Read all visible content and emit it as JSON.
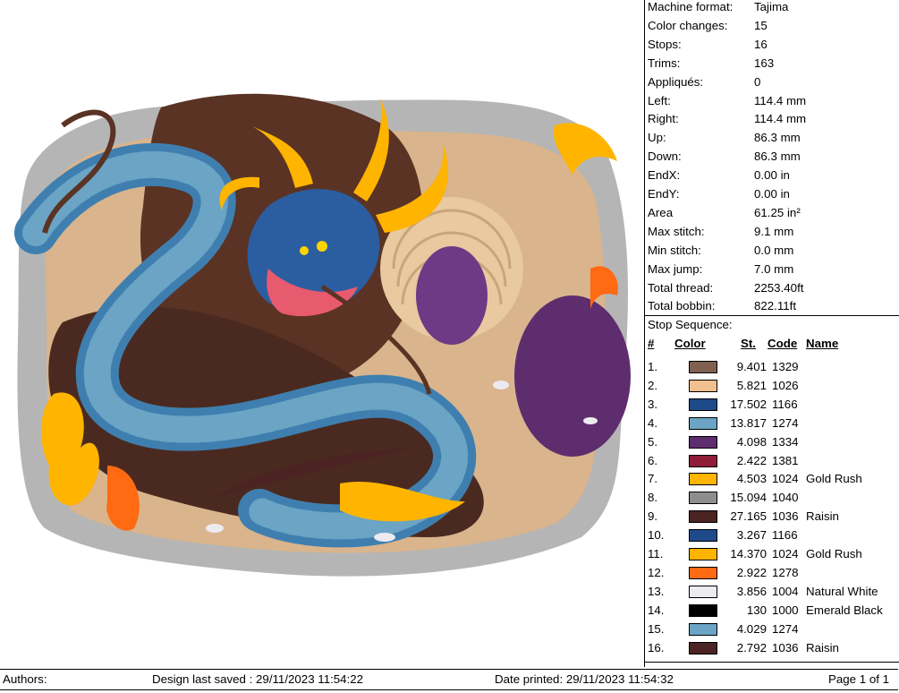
{
  "stats": [
    {
      "label": "Machine format:",
      "value": "Tajima"
    },
    {
      "label": "Color changes:",
      "value": "15"
    },
    {
      "label": "Stops:",
      "value": "16"
    },
    {
      "label": "Trims:",
      "value": "163"
    },
    {
      "label": "Appliqués:",
      "value": "0"
    },
    {
      "label": "Left:",
      "value": "114.4 mm"
    },
    {
      "label": "Right:",
      "value": "114.4 mm"
    },
    {
      "label": "Up:",
      "value": "86.3 mm"
    },
    {
      "label": "Down:",
      "value": "86.3 mm"
    },
    {
      "label": "EndX:",
      "value": "0.00 in"
    },
    {
      "label": "EndY:",
      "value": "0.00 in"
    },
    {
      "label": "Area",
      "value": " 61.25 in²"
    },
    {
      "label": "Max stitch:",
      "value": "9.1 mm"
    },
    {
      "label": "Min stitch:",
      "value": "0.0 mm"
    },
    {
      "label": "Max jump:",
      "value": "7.0 mm"
    },
    {
      "label": "Total thread:",
      "value": "2253.40ft"
    },
    {
      "label": "Total bobbin:",
      "value": "822.11ft"
    }
  ],
  "stop_sequence": {
    "title": "Stop Sequence:",
    "headers": {
      "num": "#",
      "color": "Color",
      "st": "St.",
      "code": "Code",
      "name": "Name"
    },
    "rows": [
      {
        "num": "1.",
        "color": "#80604f",
        "st": "9.401",
        "code": "1329",
        "name": ""
      },
      {
        "num": "2.",
        "color": "#f2bf8f",
        "st": "5.821",
        "code": "1026",
        "name": ""
      },
      {
        "num": "3.",
        "color": "#1e4a8a",
        "st": "17.502",
        "code": "1166",
        "name": ""
      },
      {
        "num": "4.",
        "color": "#6ba4c4",
        "st": "13.817",
        "code": "1274",
        "name": ""
      },
      {
        "num": "5.",
        "color": "#5e2d6e",
        "st": "4.098",
        "code": "1334",
        "name": ""
      },
      {
        "num": "6.",
        "color": "#8f1d3a",
        "st": "2.422",
        "code": "1381",
        "name": ""
      },
      {
        "num": "7.",
        "color": "#ffb400",
        "st": "4.503",
        "code": "1024",
        "name": "Gold Rush"
      },
      {
        "num": "8.",
        "color": "#8e8e8e",
        "st": "15.094",
        "code": "1040",
        "name": ""
      },
      {
        "num": "9.",
        "color": "#4a2322",
        "st": "27.165",
        "code": "1036",
        "name": "Raisin"
      },
      {
        "num": "10.",
        "color": "#1e4a8a",
        "st": "3.267",
        "code": "1166",
        "name": ""
      },
      {
        "num": "11.",
        "color": "#ffb400",
        "st": "14.370",
        "code": "1024",
        "name": "Gold Rush"
      },
      {
        "num": "12.",
        "color": "#ff6a13",
        "st": "2.922",
        "code": "1278",
        "name": ""
      },
      {
        "num": "13.",
        "color": "#ebebf0",
        "st": "3.856",
        "code": "1004",
        "name": "Natural White"
      },
      {
        "num": "14.",
        "color": "#000000",
        "st": "130",
        "code": "1000",
        "name": "Emerald Black"
      },
      {
        "num": "15.",
        "color": "#6ba4c4",
        "st": "4.029",
        "code": "1274",
        "name": ""
      },
      {
        "num": "16.",
        "color": "#4a2322",
        "st": "2.792",
        "code": "1036",
        "name": "Raisin"
      }
    ]
  },
  "footer": {
    "authors": "Authors:",
    "saved": "Design last saved : 29/11/2023 11:54:22",
    "printed": "Date printed: 29/11/2023 11:54:32",
    "page": "Page 1 of 1"
  }
}
